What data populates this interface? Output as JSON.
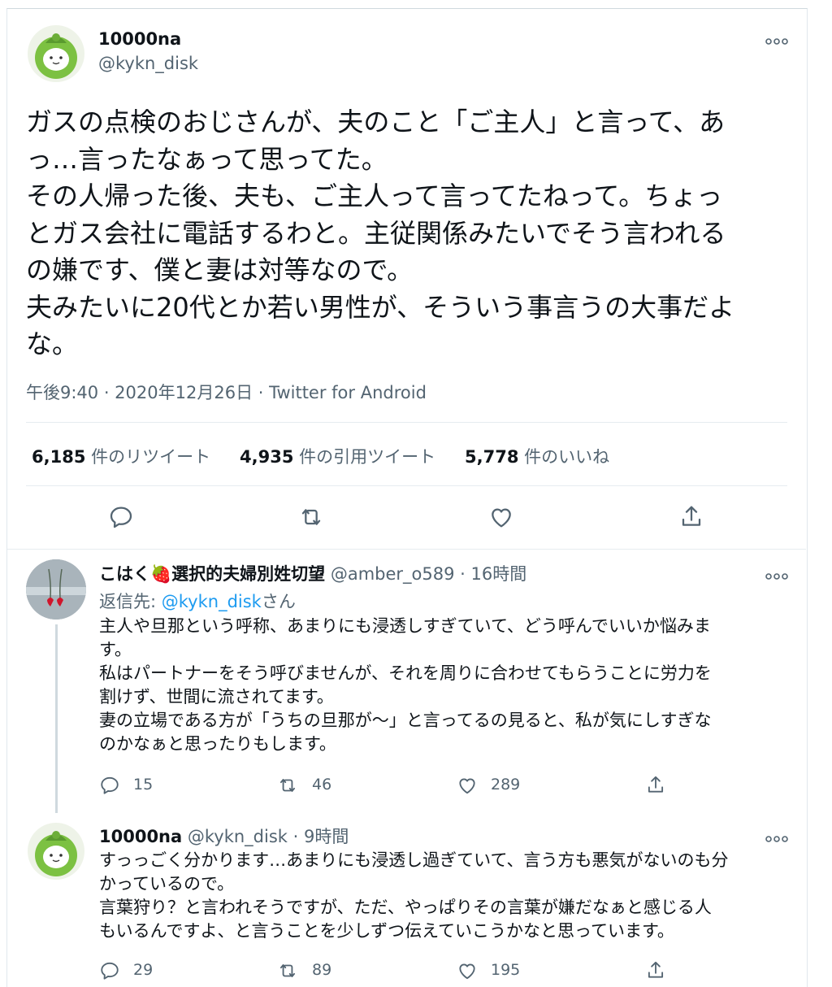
{
  "main_tweet": {
    "display_name": "10000na",
    "handle": "@kykn_disk",
    "body_lines": [
      "ガスの点検のおじさんが、夫のこと「ご主人」と言って、あ",
      "っ…言ったなぁって思ってた。",
      "その人帰った後、夫も、ご主人って言ってたねって。ちょっ",
      "とガス会社に電話するわと。主従関係みたいでそう言われる",
      "の嫌です、僕と妻は対等なので。",
      "夫みたいに20代とか若い男性が、そういう事言うの大事だよ",
      "な。"
    ],
    "meta": "午後9:40 · 2020年12月26日 · Twitter for Android",
    "stats": {
      "retweets_count": "6,185",
      "retweets_label": "件のリツイート",
      "quotes_count": "4,935",
      "quotes_label": "件の引用ツイート",
      "likes_count": "5,778",
      "likes_label": "件のいいね"
    }
  },
  "reply1": {
    "display_name": "こはく🍓選択的夫婦別姓切望",
    "handle": "@amber_o589",
    "time": "· 16時間",
    "reply_to_prefix": "返信先: ",
    "reply_to_handle": "@kykn_disk",
    "reply_to_suffix": "さん",
    "body_lines": [
      "主人や旦那という呼称、あまりにも浸透しすぎていて、どう呼んでいいか悩みま",
      "す。",
      "私はパートナーをそう呼びませんが、それを周りに合わせてもらうことに労力を",
      "割けず、世間に流されてます。",
      "妻の立場である方が「うちの旦那が〜」と言ってるの見ると、私が気にしすぎな",
      "のかなぁと思ったりもします。"
    ],
    "replies": "15",
    "retweets": "46",
    "likes": "289"
  },
  "reply2": {
    "display_name": "10000na",
    "handle": "@kykn_disk",
    "time": "· 9時間",
    "body_lines": [
      "すっっごく分かります…あまりにも浸透し過ぎていて、言う方も悪気がないのも分",
      "かっているので。",
      "言葉狩り？と言われそうですが、ただ、やっぱりその言葉が嫌だなぁと感じる人",
      "もいるんですよ、と言うことを少しずつ伝えていこうかなと思っています。"
    ],
    "replies": "29",
    "retweets": "89",
    "likes": "195"
  },
  "icons": {
    "more": "more-icon",
    "reply": "reply-icon",
    "retweet": "retweet-icon",
    "like": "like-icon",
    "share": "share-icon"
  },
  "colors": {
    "accent_blue": "#1d9bf0",
    "secondary_text": "#536471",
    "avatar_green": "#7cc142"
  }
}
